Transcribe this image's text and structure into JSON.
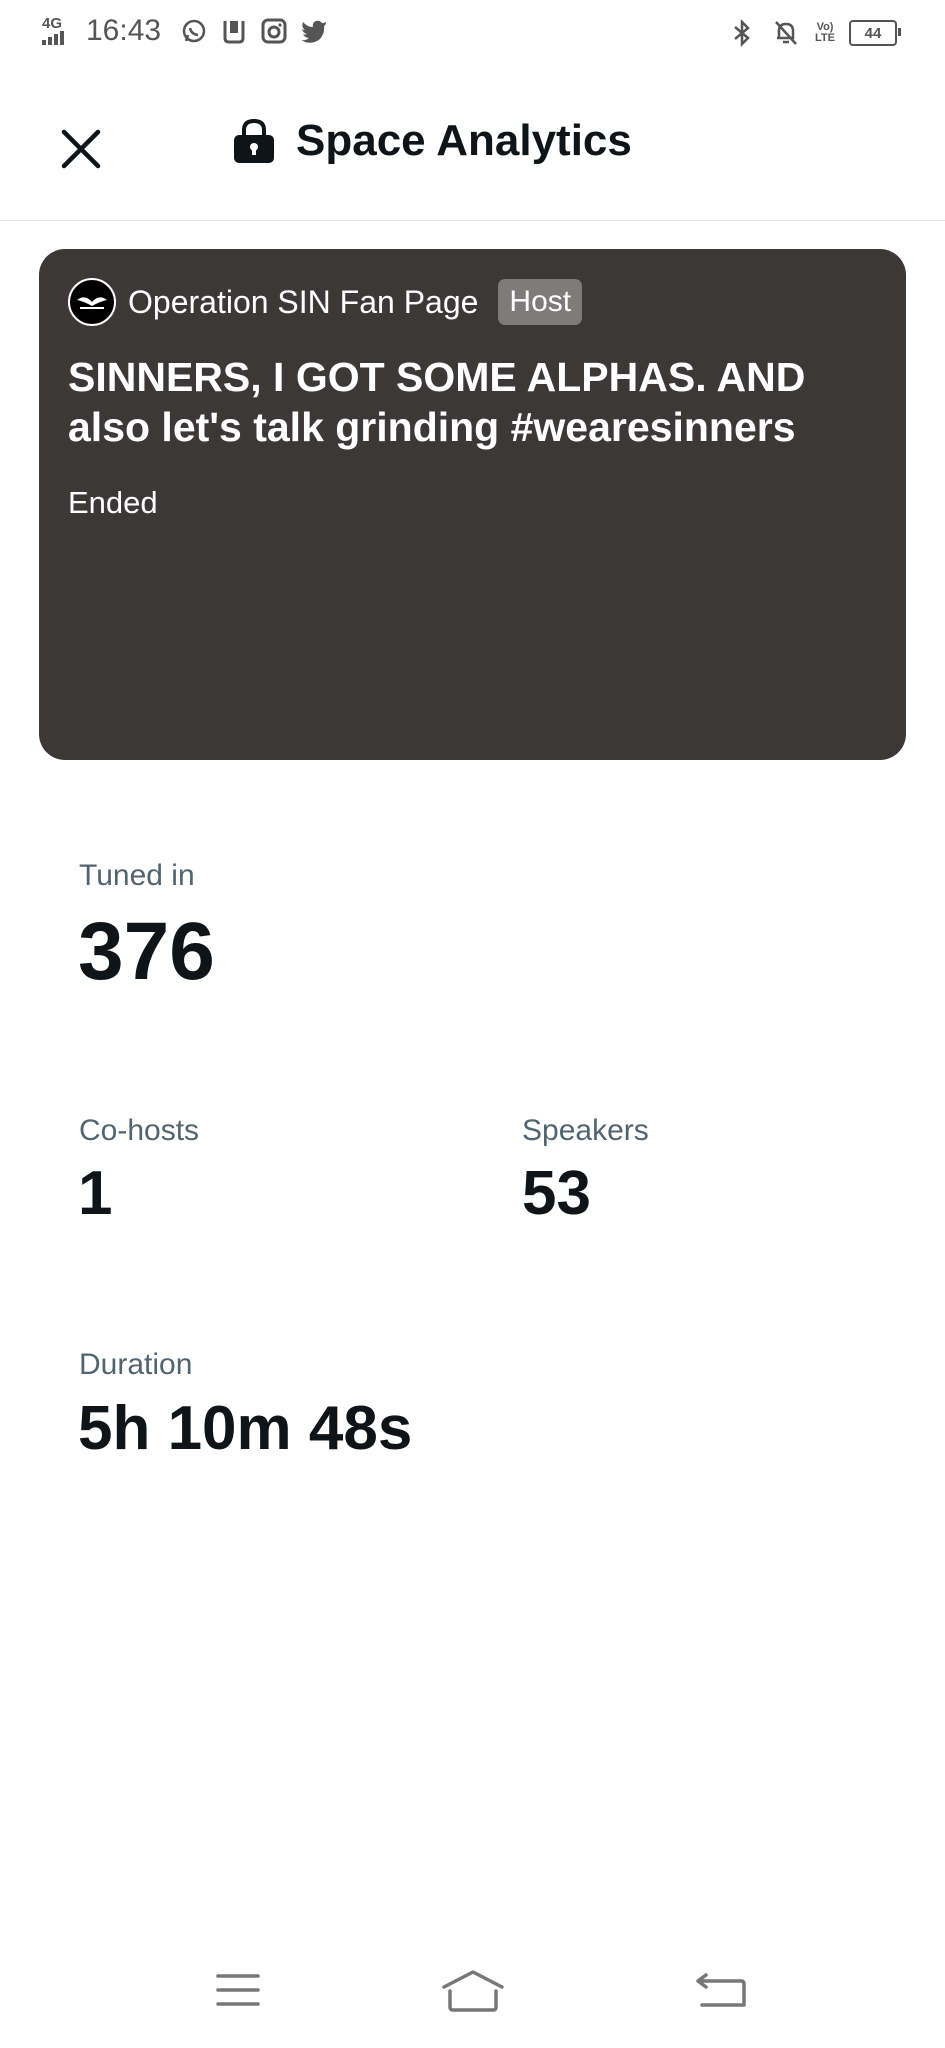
{
  "status_bar": {
    "network": "4G",
    "time": "16:43",
    "battery": "44"
  },
  "header": {
    "title": "Space Analytics"
  },
  "space": {
    "host_name": "Operation SIN Fan Page",
    "role_badge": "Host",
    "title": "SINNERS, I GOT SOME ALPHAS. AND also let's talk grinding #wearesinners",
    "status": "Ended"
  },
  "stats": {
    "tuned_in": {
      "label": "Tuned in",
      "value": "376"
    },
    "co_hosts": {
      "label": "Co-hosts",
      "value": "1"
    },
    "speakers": {
      "label": "Speakers",
      "value": "53"
    },
    "duration": {
      "label": "Duration",
      "value": "5h 10m 48s"
    }
  },
  "colors": {
    "card_bg": "#3d3838",
    "badge_bg": "#807b7b",
    "label": "#536471",
    "text": "#0f1419"
  },
  "icons": [
    "close-icon",
    "lock-icon",
    "menu-icon",
    "home-icon",
    "back-icon"
  ]
}
